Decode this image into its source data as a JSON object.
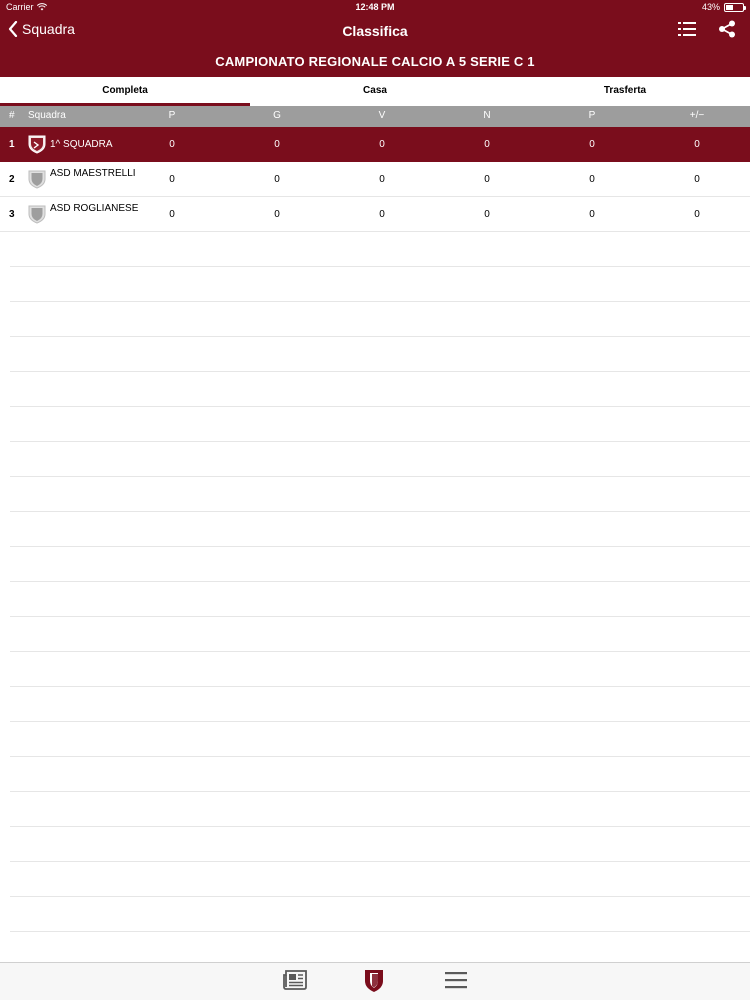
{
  "status_bar": {
    "carrier": "Carrier",
    "time": "12:48 PM",
    "battery": "43%",
    "battery_level": 0.43
  },
  "nav": {
    "back_label": "Squadra",
    "title": "Classifica"
  },
  "league": {
    "title": "CAMPIONATO REGIONALE CALCIO A 5 SERIE C 1"
  },
  "tabs": [
    {
      "label": "Completa",
      "active": true
    },
    {
      "label": "Casa",
      "active": false
    },
    {
      "label": "Trasferta",
      "active": false
    }
  ],
  "table": {
    "headers": [
      "#",
      "Squadra",
      "P",
      "G",
      "V",
      "N",
      "P",
      "+/−"
    ],
    "rows": [
      {
        "pos": "1",
        "name": "1^ SQUADRA",
        "values": [
          "0",
          "0",
          "0",
          "0",
          "0",
          "0"
        ],
        "highlight": true
      },
      {
        "pos": "2",
        "name": "ASD MAESTRELLI",
        "values": [
          "0",
          "0",
          "0",
          "0",
          "0",
          "0"
        ],
        "highlight": false
      },
      {
        "pos": "3",
        "name": "ASD ROGLIANESE",
        "values": [
          "0",
          "0",
          "0",
          "0",
          "0",
          "0"
        ],
        "highlight": false
      }
    ]
  },
  "colors": {
    "brand": "#7a0d1c",
    "header_gray": "#9d9d9d"
  },
  "icons": {
    "back": "chevron-left-icon",
    "list": "list-icon",
    "share": "share-icon",
    "news": "newspaper-icon",
    "team": "shield-icon",
    "menu": "hamburger-menu-icon"
  }
}
